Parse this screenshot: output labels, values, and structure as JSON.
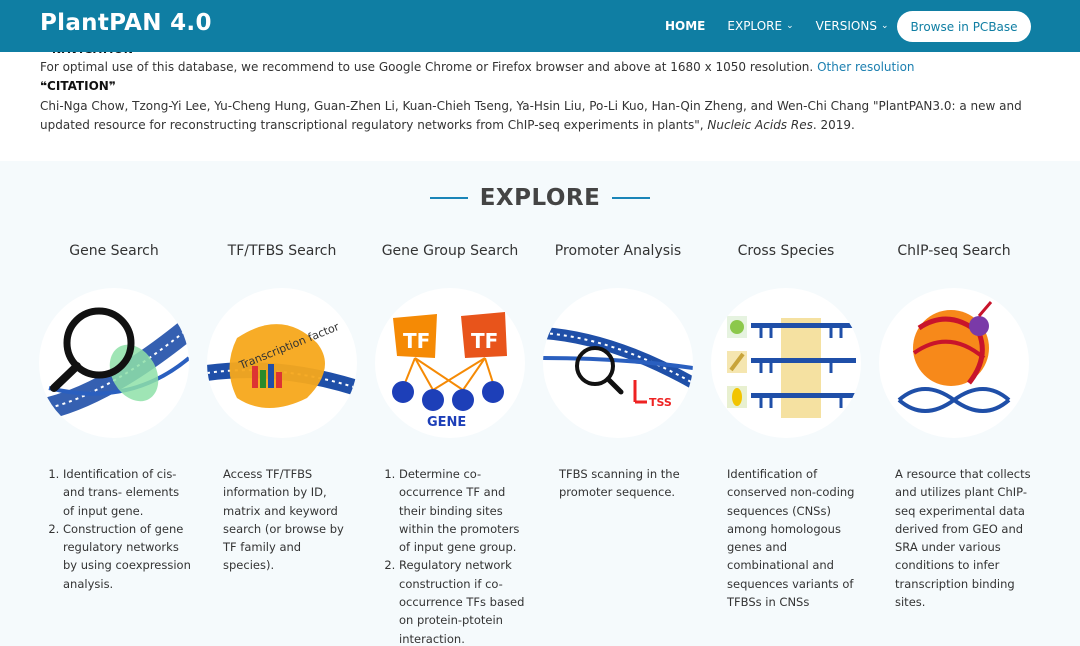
{
  "header": {
    "brand": "PlantPAN 4.0",
    "nav": [
      {
        "label": "HOME"
      },
      {
        "label": "EXPLORE"
      },
      {
        "label": "VERSIONS"
      }
    ],
    "pcbase_label": "Browse in PCBase"
  },
  "cut_heading": "NAVIGATION",
  "notice": {
    "text": "For optimal use of this database, we recommend to use Google Chrome or Firefox browser and above at 1680 x 1050 resolution.",
    "link": "Other resolution"
  },
  "citation": {
    "heading": "❝CITATION❞",
    "authors": "Chi-Nga Chow, Tzong-Yi Lee, Yu-Cheng Hung, Guan-Zhen Li, Kuan-Chieh Tseng, Ya-Hsin Liu, Po-Li Kuo, Han-Qin Zheng, and Wen-Chi Chang \"PlantPAN3.0: a new and updated resource for reconstructing transcriptional regulatory networks from ChIP-seq experiments in plants\",",
    "journal": "Nucleic Acids Res",
    "year": ". 2019."
  },
  "explore": {
    "title": "EXPLORE",
    "columns": [
      {
        "title": "Gene Search",
        "icon": "magnifier-dna-icon",
        "items": [
          "Identification of cis- and trans- elements of input gene.",
          "Construction of gene regulatory networks by using coexpression analysis."
        ]
      },
      {
        "title": "TF/TFBS Search",
        "icon": "transcription-factor-icon",
        "icon_label": "Transcription factor",
        "text": "Access TF/TFBS information by ID, matrix and keyword search (or browse by TF family and species)."
      },
      {
        "title": "Gene Group Search",
        "icon": "tf-gene-network-icon",
        "icon_tf": "TF",
        "icon_gene": "GENE",
        "items": [
          "Determine co-occurrence TF and their binding sites within the promoters of input gene group.",
          "Regulatory network construction if co-occurrence TFs based on protein-ptotein interaction."
        ]
      },
      {
        "title": "Promoter Analysis",
        "icon": "promoter-magnifier-icon",
        "icon_tss": "TSS",
        "text": "TFBS scanning in the promoter sequence."
      },
      {
        "title": "Cross Species",
        "icon": "cross-species-icon",
        "text": "Identification of conserved non-coding sequences (CNSs) among homologous genes and combinational and sequences variants of TFBSs in CNSs"
      },
      {
        "title": "ChIP-seq Search",
        "icon": "chip-seq-icon",
        "text": "A resource that collects and utilizes plant ChIP-seq experimental data derived from GEO and SRA under various conditions to infer transcription binding sites."
      }
    ]
  }
}
